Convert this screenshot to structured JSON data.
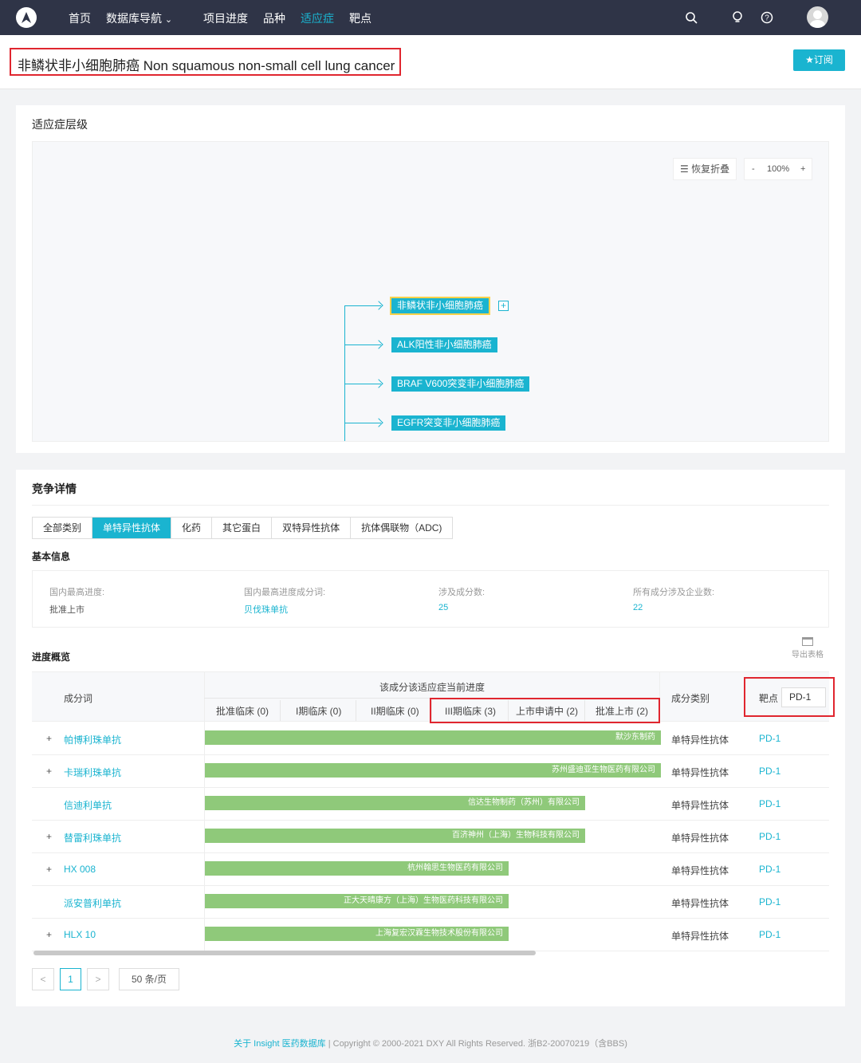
{
  "nav": {
    "items": [
      "首页",
      "数据库导航",
      "项目进度",
      "品种",
      "适应症",
      "靶点"
    ],
    "active_index": 4,
    "dropdown_glyph": "⌄",
    "icons": [
      "logo-icon",
      "search-icon",
      "bulb-icon",
      "help-icon",
      "avatar"
    ]
  },
  "header": {
    "title": "非鳞状非小细胞肺癌 Non squamous non-small cell lung cancer",
    "subscribe_label": "★订阅"
  },
  "hierarchy": {
    "title": "适应症层级",
    "restore_label": "恢复折叠",
    "zoom_minus": "-",
    "zoom_value": "100%",
    "zoom_plus": "+",
    "expand_glyph": "+",
    "nodes": [
      "非鳞状非小细胞肺癌",
      "ALK阳性非小细胞肺癌",
      "BRAF V600突变非小细胞肺癌",
      "EGFR突变非小细胞肺癌"
    ]
  },
  "competition": {
    "title": "竞争详情",
    "tabs": [
      "全部类别",
      "单特异性抗体",
      "化药",
      "其它蛋白",
      "双特异性抗体",
      "抗体偶联物（ADC)"
    ],
    "active_tab": 1,
    "basic_info_title": "基本信息",
    "info": [
      {
        "k": "国内最高进度:",
        "v": "批准上市"
      },
      {
        "k": "国内最高进度成分词:",
        "v": "贝伐珠单抗"
      },
      {
        "k": "涉及成分数:",
        "v": "25"
      },
      {
        "k": "所有成分涉及企业数:",
        "v": "22"
      }
    ],
    "progress_title": "进度概览",
    "export_label": "导出表格",
    "col_component": "成分词",
    "col_progress": "该成分该适应症当前进度",
    "stages": [
      "批准临床 (0)",
      "I期临床 (0)",
      "II期临床 (0)",
      "III期临床 (3)",
      "上市申请中 (2)",
      "批准上市 (2)"
    ],
    "col_category": "成分类别",
    "col_target": "靶点",
    "target_filter": "PD-1",
    "row_expand_glyph": "+",
    "rows": [
      {
        "expand": true,
        "name": "帕博利珠单抗",
        "company": "默沙东制药",
        "stage_level": 6,
        "category": "单特异性抗体",
        "target": "PD-1"
      },
      {
        "expand": true,
        "name": "卡瑞利珠单抗",
        "company": "苏州盛迪亚生物医药有限公司",
        "stage_level": 6,
        "category": "单特异性抗体",
        "target": "PD-1"
      },
      {
        "expand": false,
        "name": "信迪利单抗",
        "company": "信达生物制药（苏州）有限公司",
        "stage_level": 5,
        "category": "单特异性抗体",
        "target": "PD-1"
      },
      {
        "expand": true,
        "name": "替雷利珠单抗",
        "company": "百济神州（上海）生物科技有限公司",
        "stage_level": 5,
        "category": "单特异性抗体",
        "target": "PD-1"
      },
      {
        "expand": true,
        "name": "HX 008",
        "company": "杭州翰思生物医药有限公司",
        "stage_level": 4,
        "category": "单特异性抗体",
        "target": "PD-1"
      },
      {
        "expand": false,
        "name": "派安普利单抗",
        "company": "正大天晴康方（上海）生物医药科技有限公司",
        "stage_level": 4,
        "category": "单特异性抗体",
        "target": "PD-1"
      },
      {
        "expand": true,
        "name": "HLX 10",
        "company": "上海复宏汉霖生物技术股份有限公司",
        "stage_level": 4,
        "category": "单特异性抗体",
        "target": "PD-1"
      }
    ],
    "pager": {
      "prev": "<",
      "page": "1",
      "next": ">",
      "size": "50 条/页"
    }
  },
  "footer": {
    "about": "关于 Insight 医药数据库",
    "sep": "|",
    "copyright": "Copyright © 2000-2021 DXY All Rights Reserved. 浙B2-20070219（含BBS)"
  },
  "colors": {
    "accent": "#1ab4d0",
    "nav_bg": "#2f3447",
    "bar": "#8fc97a",
    "highlight": "#e0262f"
  }
}
